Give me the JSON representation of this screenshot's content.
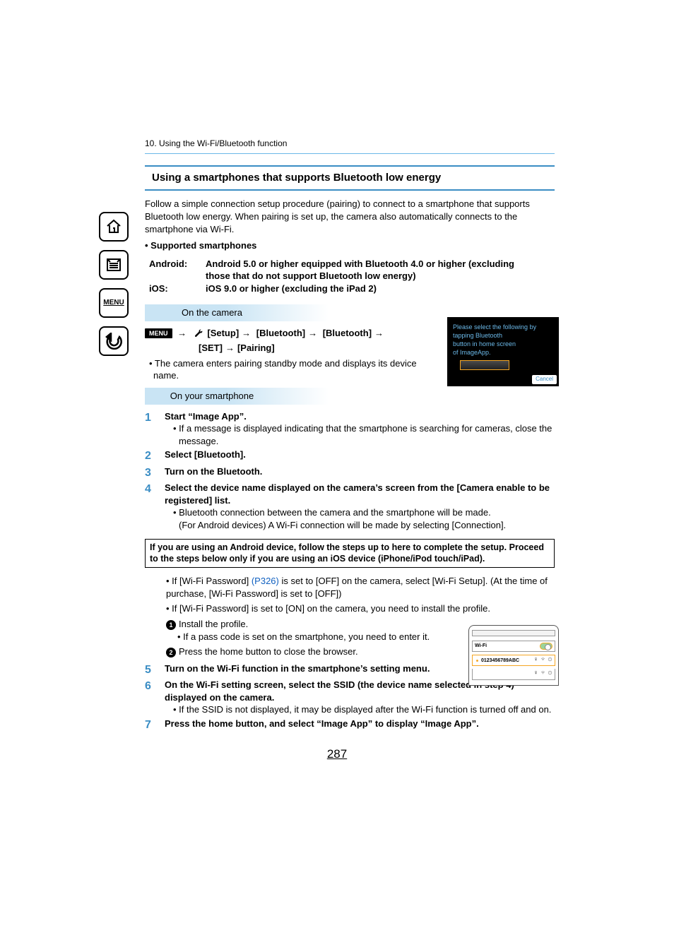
{
  "chapter": "10. Using the Wi-Fi/Bluetooth function",
  "section_title": "Using a smartphones that supports Bluetooth low energy",
  "intro": "Follow a simple connection setup procedure (pairing) to connect to a smartphone that supports Bluetooth low energy. When pairing is set up, the camera also automatically connects to the smartphone via Wi-Fi.",
  "supported_heading": "• Supported smartphones",
  "support": {
    "android_label": "Android:",
    "android_val": "Android 5.0 or higher equipped with Bluetooth 4.0 or higher (excluding those that do not support Bluetooth low energy)",
    "ios_label": "iOS:",
    "ios_val": "iOS 9.0 or higher (excluding the iPad 2)"
  },
  "on_camera": "On the camera",
  "menu_badge": "MENU",
  "menu_path": {
    "setup": "[Setup]",
    "bt1": "[Bluetooth]",
    "bt2": "[Bluetooth]",
    "set": "[SET]",
    "pairing": "[Pairing]"
  },
  "camera_note": "• The camera enters pairing standby mode and displays its device name.",
  "phone_screen": {
    "line1": "Please select the following by",
    "line2": "tapping Bluetooth",
    "line3": "button in home screen",
    "line4": "of ImageApp.",
    "cancel": "Cancel"
  },
  "on_phone": "On your smartphone",
  "steps": {
    "s1_title": "Start “Image App”.",
    "s1_note": "• If a message is displayed indicating that the smartphone is searching for cameras, close the message.",
    "s2_title": "Select [Bluetooth].",
    "s3_title": "Turn on the Bluetooth.",
    "s4_title": "Select the device name displayed on the camera’s screen from the [Camera enable to be registered] list.",
    "s4_note1": "• Bluetooth connection between the camera and the smartphone will be made.",
    "s4_note2": "(For Android devices) A Wi-Fi connection will be made by selecting [Connection].",
    "s5_title": "Turn on the Wi-Fi function in the smartphone’s setting menu.",
    "s6_title_a": "On the Wi-Fi setting screen, select the SSID (the device name selected in step ",
    "s6_step_ref": "4",
    "s6_title_b": ") displayed on the camera.",
    "s6_note": "• If the SSID is not displayed, it may be displayed after the Wi-Fi function is turned off and on.",
    "s7_title": "Press the home button, and select “Image App” to display “Image App”."
  },
  "notice_box": "If you are using an Android device, follow the steps up to here to complete the setup. Proceed to the steps below only if you are using an iOS device (iPhone/iPod touch/iPad).",
  "after_box": {
    "a1_pre": "• If [Wi-Fi Password] ",
    "a1_link": "(P326)",
    "a1_post": " is set to [OFF] on the camera, select [Wi-Fi Setup]. (At the time of purchase, [Wi-Fi Password] is set to [OFF])",
    "a2": "• If [Wi-Fi Password] is set to [ON] on the camera, you need to install the profile.",
    "b1": "Install the profile.",
    "b1_sub": "• If a pass code is set on the smartphone, you need to enter it.",
    "b2": "Press the home button to close the browser."
  },
  "wifi_diagram": {
    "label": "Wi-Fi",
    "ssid": "0123456789ABC"
  },
  "page_number": "287"
}
